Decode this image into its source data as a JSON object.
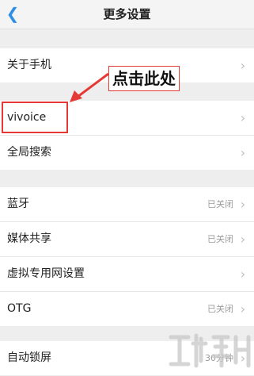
{
  "header": {
    "title": "更多设置",
    "back_icon": "chevron-left-icon"
  },
  "groups": [
    {
      "rows": [
        {
          "label": "关于手机"
        }
      ]
    },
    {
      "rows": [
        {
          "label": "vivoice"
        },
        {
          "label": "全局搜索"
        }
      ]
    },
    {
      "rows": [
        {
          "label": "蓝牙",
          "value": "已关闭"
        },
        {
          "label": "媒体共享",
          "value": "已关闭"
        },
        {
          "label": "虚拟专用网设置"
        },
        {
          "label": "OTG",
          "value": "已关闭"
        }
      ]
    },
    {
      "rows": [
        {
          "label": "自动锁屏",
          "value": "30分钟"
        }
      ]
    }
  ],
  "annotation": {
    "callout_text": "点击此处",
    "color": "#e53935"
  },
  "colors": {
    "accent": "#2f8fe6",
    "page_bg": "#eeeeee"
  }
}
